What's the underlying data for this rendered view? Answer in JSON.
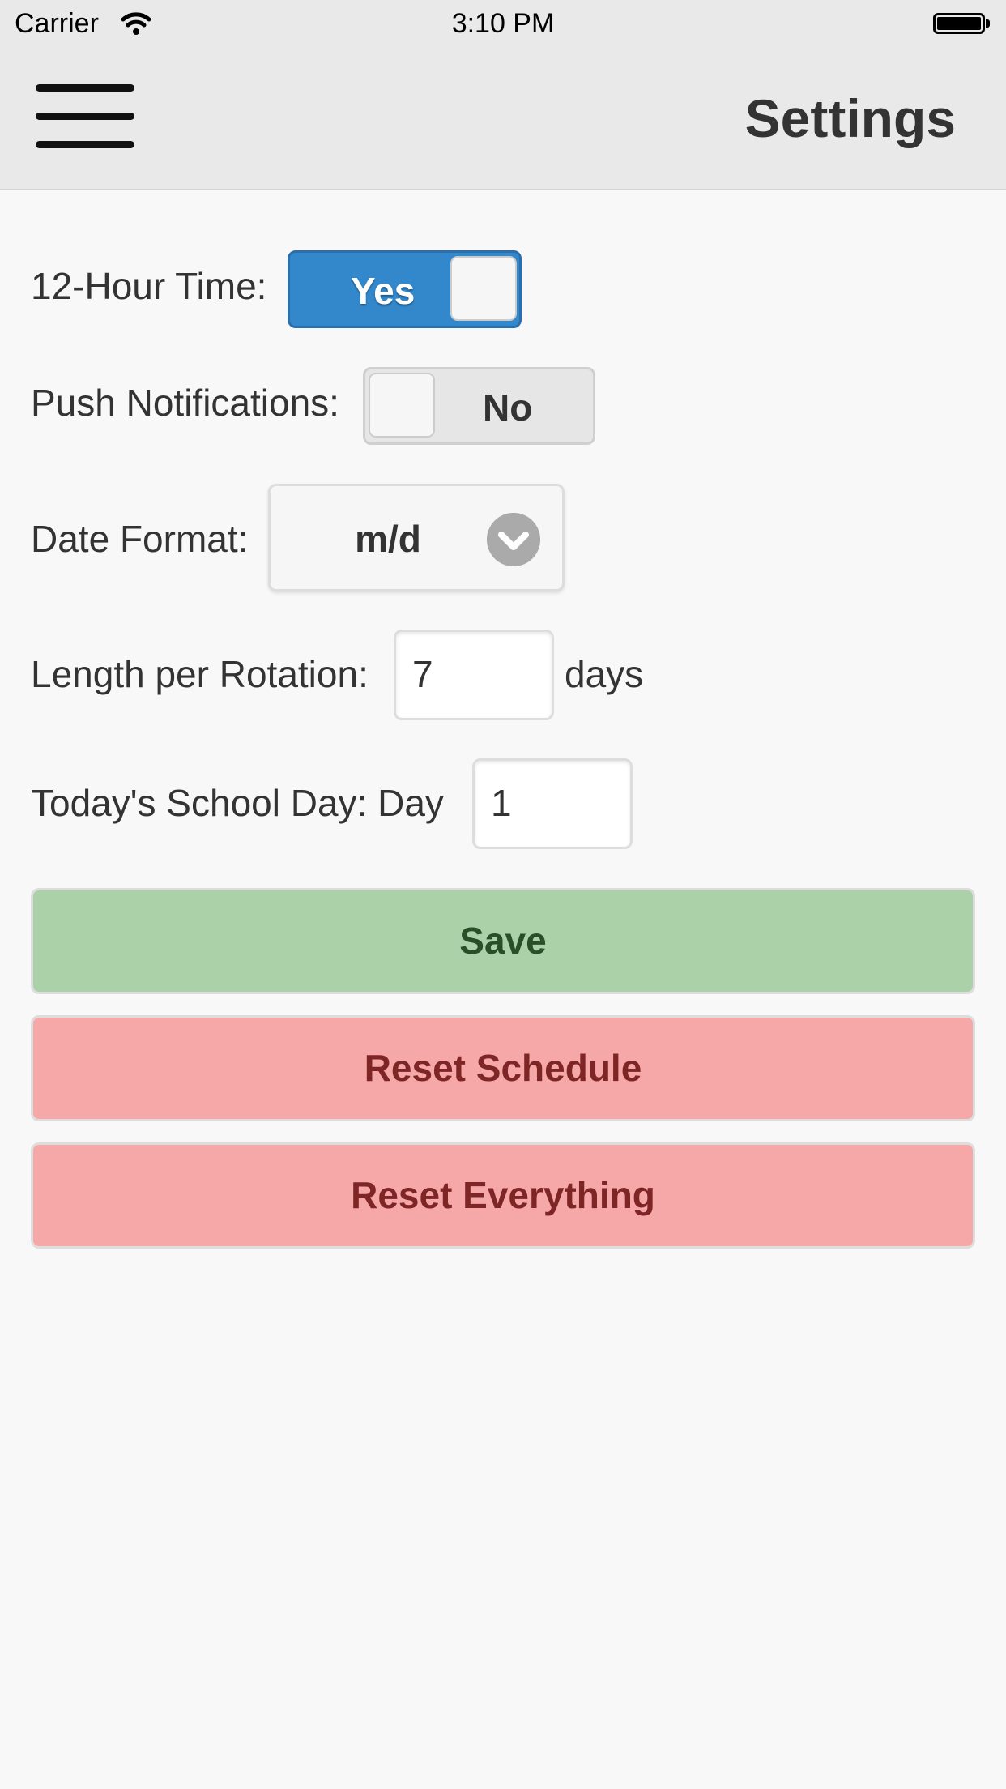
{
  "status_bar": {
    "carrier": "Carrier",
    "time": "3:10 PM",
    "wifi_icon": "wifi-icon",
    "battery_icon": "battery-icon"
  },
  "header": {
    "title": "Settings",
    "menu_icon": "hamburger-menu-icon"
  },
  "settings": {
    "twelve_hour": {
      "label": "12-Hour Time:",
      "state_label": "Yes",
      "on": true
    },
    "push": {
      "label": "Push Notifications:",
      "state_label": "No",
      "on": false
    },
    "date_format": {
      "label": "Date Format:",
      "value": "m/d",
      "icon": "chevron-down-icon"
    },
    "rotation": {
      "label": "Length per Rotation:",
      "value": "7",
      "unit": "days"
    },
    "school_day": {
      "label": "Today's School Day: Day",
      "value": "1"
    }
  },
  "buttons": {
    "save": "Save",
    "reset_schedule": "Reset Schedule",
    "reset_everything": "Reset Everything"
  },
  "colors": {
    "toggle_on": "#3388cc",
    "save_bg": "#abd1a8",
    "reset_bg": "#f6a8a8"
  }
}
